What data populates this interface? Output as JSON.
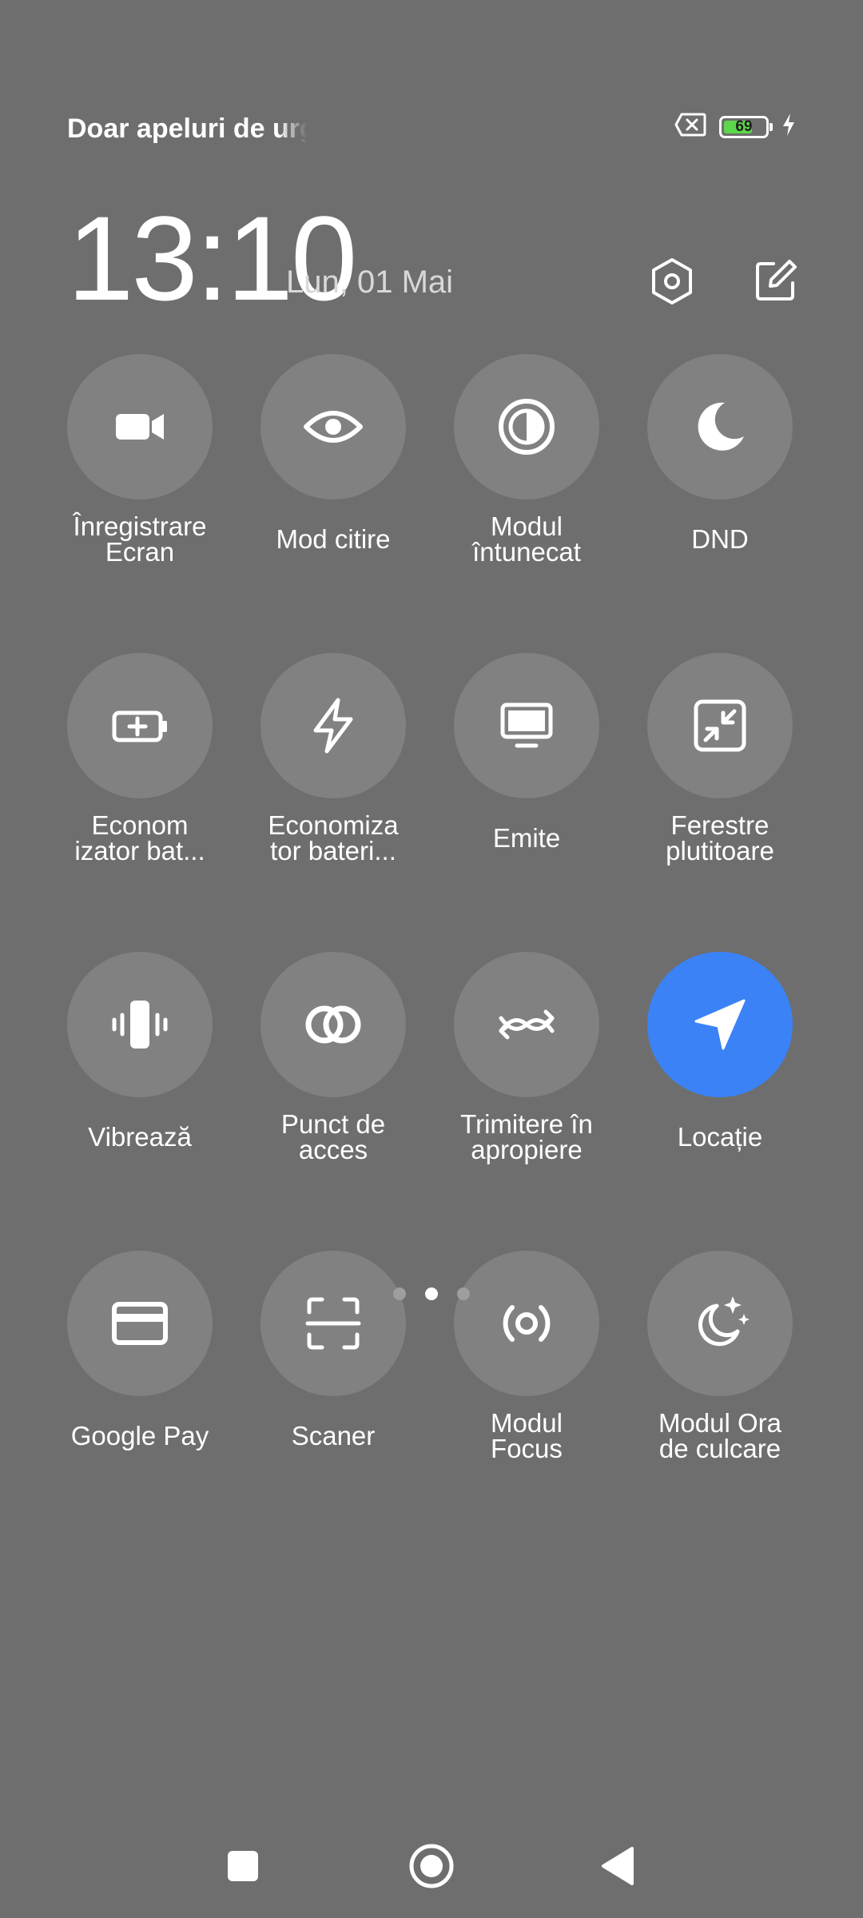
{
  "status": {
    "text": "Doar apeluri de urgență",
    "battery_level": "69",
    "battery_fraction": 0.69,
    "battery_color": "#5cd64b"
  },
  "header": {
    "time": "13:10",
    "date": "Lun, 01 Mai"
  },
  "tiles": [
    {
      "line1": "Înregistrare",
      "line2": "Ecran",
      "icon": "video-camera-icon",
      "active": false
    },
    {
      "line1": "Mod citire",
      "line2": "",
      "icon": "eye-icon",
      "active": false
    },
    {
      "line1": "Modul",
      "line2": "întunecat",
      "icon": "dark-mode-icon",
      "active": false
    },
    {
      "line1": "DND",
      "line2": "",
      "icon": "moon-icon",
      "active": false
    },
    {
      "line1": "Econom",
      "line2": "izator bat...",
      "icon": "battery-saver-icon",
      "active": false
    },
    {
      "line1": "Economiza",
      "line2": "tor bateri...",
      "icon": "lightning-icon",
      "active": false
    },
    {
      "line1": "Emite",
      "line2": "",
      "icon": "cast-screen-icon",
      "active": false
    },
    {
      "line1": "Ferestre",
      "line2": "plutitoare",
      "icon": "floating-window-icon",
      "active": false
    },
    {
      "line1": "Vibrează",
      "line2": "",
      "icon": "vibrate-icon",
      "active": false
    },
    {
      "line1": "Punct de",
      "line2": "acces",
      "icon": "hotspot-link-icon",
      "active": false
    },
    {
      "line1": "Trimitere în",
      "line2": "apropiere",
      "icon": "nearby-share-icon",
      "active": false
    },
    {
      "line1": "Locație",
      "line2": "",
      "icon": "location-arrow-icon",
      "active": true
    },
    {
      "line1": "Google Pay",
      "line2": "",
      "icon": "credit-card-icon",
      "active": false
    },
    {
      "line1": "Scaner",
      "line2": "",
      "icon": "scanner-icon",
      "active": false
    },
    {
      "line1": "Modul",
      "line2": "Focus",
      "icon": "focus-mode-icon",
      "active": false
    },
    {
      "line1": "Modul Ora",
      "line2": "de culcare",
      "icon": "bedtime-icon",
      "active": false
    }
  ],
  "pager": {
    "count": 3,
    "active_index": 1
  },
  "colors": {
    "background": "#6e6e6e",
    "tile_inactive": "#818181",
    "tile_active": "#3b82f6"
  }
}
